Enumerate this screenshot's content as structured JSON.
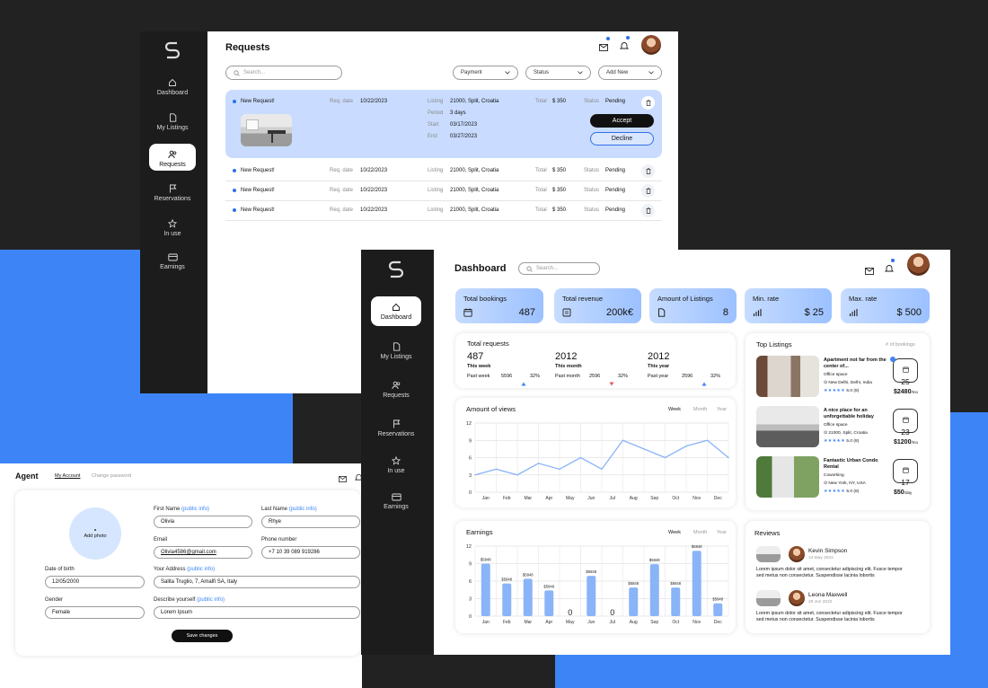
{
  "requests_window": {
    "title": "Requests",
    "search_placeholder": "Search...",
    "filters": [
      "Payment",
      "Status",
      "Add New"
    ],
    "nav": [
      {
        "label": "Dashboard",
        "icon": "home-icon"
      },
      {
        "label": "My Listings",
        "icon": "document-icon"
      },
      {
        "label": "Requests",
        "icon": "users-icon",
        "active": true
      },
      {
        "label": "Reservations",
        "icon": "flag-icon"
      },
      {
        "label": "In use",
        "icon": "star-icon"
      },
      {
        "label": "Earnings",
        "icon": "card-icon"
      }
    ],
    "expanded": {
      "title": "New Request!",
      "req_label": "Req. date",
      "req_date": "10/22/2023",
      "listing_label": "Listing",
      "listing": "21000, Split, Croatia",
      "period_label": "Period",
      "period": "3 days",
      "start_label": "Start",
      "start": "03/17/2023",
      "end_label": "End",
      "end": "03/27/2023",
      "total_label": "Total",
      "total": "$ 350",
      "status_label": "Status",
      "status": "Pending",
      "accept": "Accept",
      "decline": "Decline"
    },
    "rows": [
      {
        "title": "New Request!",
        "req_label": "Req. date",
        "req_date": "10/22/2023",
        "listing_label": "Listing",
        "listing": "21000, Split, Croatia",
        "total_label": "Total",
        "total": "$ 350",
        "status_label": "Status",
        "status": "Pending"
      },
      {
        "title": "New Request!",
        "req_label": "Req. date",
        "req_date": "10/22/2023",
        "listing_label": "Listing",
        "listing": "21000, Split, Croatia",
        "total_label": "Total",
        "total": "$ 350",
        "status_label": "Status",
        "status": "Pending"
      },
      {
        "title": "New Request!",
        "req_label": "Req. date",
        "req_date": "10/22/2023",
        "listing_label": "Listing",
        "listing": "21000, Split, Croatia",
        "total_label": "Total",
        "total": "$ 350",
        "status_label": "Status",
        "status": "Pending"
      }
    ]
  },
  "agent_window": {
    "title": "Agent",
    "tabs": [
      "My Account",
      "Change password"
    ],
    "add_photo": "Add photo",
    "public_info": "(public info)",
    "first_name_label": "First Name",
    "first_name": "Olivia",
    "last_name_label": "Last Name",
    "last_name": "Rhye",
    "email_label": "Email",
    "email": "Olivia4586@gmail.com",
    "phone_label": "Phone number",
    "phone": "+7 10 39 089 919286",
    "dob_label": "Date of birth",
    "dob": "12/05/2000",
    "address_label": "Your Address",
    "address": "Salita Truglio, 7, Amalfi SA, Italy",
    "gender_label": "Gender",
    "gender": "Female",
    "describe_label": "Describe yourself",
    "describe": "Lorem Ipsum",
    "save": "Save changes"
  },
  "dashboard": {
    "title": "Dashboard",
    "search_placeholder": "Search...",
    "nav": [
      {
        "label": "Dashboard",
        "icon": "home-icon",
        "active": true
      },
      {
        "label": "My Listings",
        "icon": "document-icon"
      },
      {
        "label": "Requests",
        "icon": "users-icon"
      },
      {
        "label": "Reservations",
        "icon": "flag-icon"
      },
      {
        "label": "In use",
        "icon": "star-icon"
      },
      {
        "label": "Earnings",
        "icon": "card-icon"
      }
    ],
    "kpis": [
      {
        "title": "Total bookings",
        "value": "487",
        "icon": "calendar-icon"
      },
      {
        "title": "Total revenue",
        "value": "200k€",
        "icon": "wallet-icon"
      },
      {
        "title": "Amount of Listings",
        "value": "8",
        "icon": "document-icon"
      },
      {
        "title": "Min. rate",
        "value": "$ 25",
        "icon": "bars-icon"
      },
      {
        "title": "Max. rate",
        "value": "$ 500",
        "icon": "bars-icon"
      }
    ],
    "total_requests": {
      "title": "Total requests",
      "cols": [
        {
          "value": "487",
          "period": "This week",
          "past_label": "Past week",
          "past": "5596",
          "pct": "32%",
          "dir": "up"
        },
        {
          "value": "2012",
          "period": "This month",
          "past_label": "Past month",
          "past": "2596",
          "pct": "32%",
          "dir": "down"
        },
        {
          "value": "2012",
          "period": "This year",
          "past_label": "Past year",
          "past": "2596",
          "pct": "32%",
          "dir": "up"
        }
      ]
    },
    "range_tabs": [
      "Week",
      "Month",
      "Year"
    ],
    "top_listings": {
      "title": "Top Listings",
      "subtitle": "# of bookings",
      "items": [
        {
          "name": "Apartment not far from the center of...",
          "type": "Office space",
          "location": "New Delhi, Delhi, India",
          "rating": "5.0 (8)",
          "bookings": "25",
          "price": "$2480",
          "unit": "/mo"
        },
        {
          "name": "A nice place for an unforgettable holiday",
          "type": "Office space",
          "location": "21000, Split, Croatia",
          "rating": "5.0 (8)",
          "bookings": "23",
          "price": "$1200",
          "unit": "/mo"
        },
        {
          "name": "Fantastic Urban Condo Rental",
          "type": "Coworking",
          "location": "New York, NY, USA",
          "rating": "5.0 (8)",
          "bookings": "17",
          "price": "$50",
          "unit": "/day"
        }
      ]
    },
    "reviews": {
      "title": "Reviews",
      "items": [
        {
          "name": "Kevin Simpson",
          "date": "14 May 2022",
          "text1": "Lorem ipsum dolor sit amet, consectetur adipiscing elit. Fusce tempor",
          "text2": "sed metus non consectetur. Suspendisse lacinia lobortis"
        },
        {
          "name": "Leona Maxwell",
          "date": "29 Jun 2022",
          "text1": "Lorem ipsum dolor sit amet, consectetur adipiscing elit. Fusce tempor",
          "text2": "sed metus non consectetur. Suspendisse lacinia lobortis"
        }
      ]
    }
  },
  "chart_data": [
    {
      "type": "line",
      "title": "Amount of views",
      "categories": [
        "Jan",
        "Feb",
        "Mar",
        "Apr",
        "May",
        "Jun",
        "Jul",
        "Aug",
        "Sep",
        "Oct",
        "Nov",
        "Dec"
      ],
      "values": [
        3,
        4,
        3,
        5,
        4,
        6,
        4,
        9,
        7.5,
        6,
        8,
        9,
        6
      ],
      "ylim": [
        0,
        12
      ],
      "yticks": [
        "0",
        "3",
        "6",
        "9",
        "12"
      ],
      "color": "#8ab4f8",
      "grid": true
    },
    {
      "type": "bar",
      "title": "Earnings",
      "categories": [
        "Jan",
        "Feb",
        "Mar",
        "Apr",
        "May",
        "Jun",
        "Jul",
        "Aug",
        "Sep",
        "Oct",
        "Nov",
        "Dec"
      ],
      "values": [
        9,
        5.6,
        6.4,
        4.4,
        0,
        6.9,
        0,
        4.9,
        8.9,
        4.9,
        11.2,
        2.2
      ],
      "labels": [
        "$5848",
        "$5848",
        "$5848",
        "$5848",
        "0",
        "$5848",
        "0",
        "$5848",
        "$5848",
        "$5848",
        "$5848",
        "$5848"
      ],
      "ylim": [
        0,
        12
      ],
      "yticks": [
        "0",
        "3",
        "6",
        "9",
        "12"
      ],
      "color": "#8ab4f8",
      "grid": true
    }
  ]
}
